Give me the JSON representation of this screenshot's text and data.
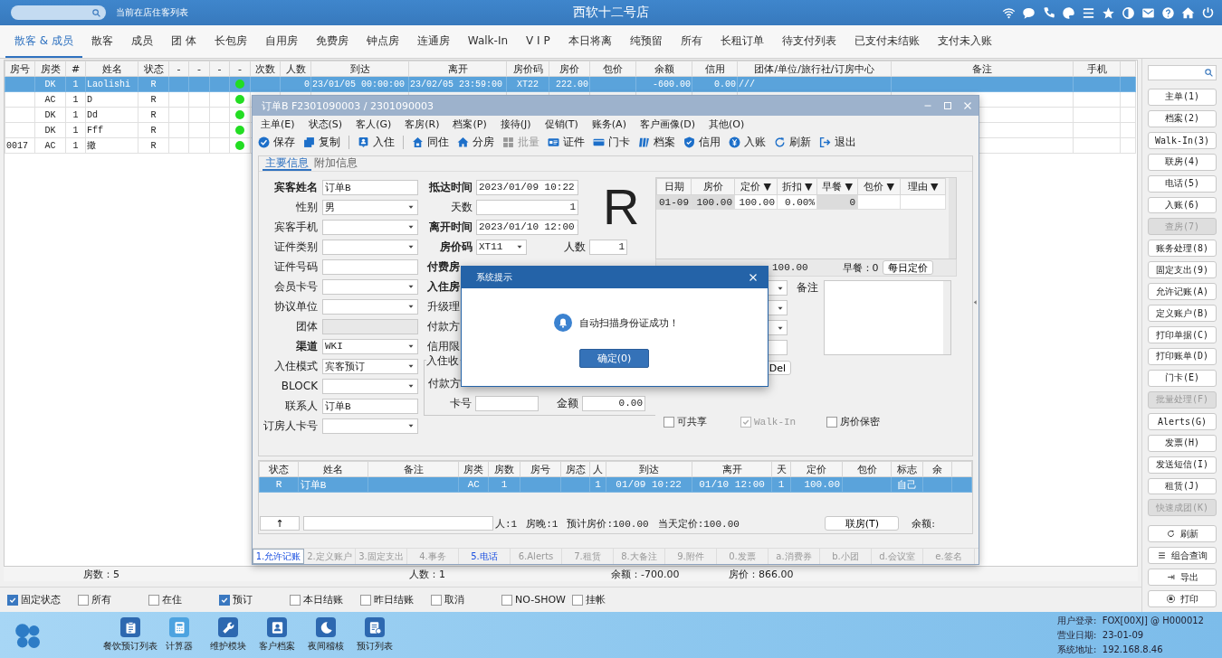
{
  "top_bar": {
    "subtitle": "当前在店住客列表",
    "title": "西软十二号店"
  },
  "tabs": [
    {
      "label": "散客 & 成员",
      "selected": true
    },
    {
      "label": "散客",
      "selected": false
    },
    {
      "label": "成员",
      "selected": false
    },
    {
      "label": "团 体",
      "selected": false
    },
    {
      "label": "长包房",
      "selected": false
    },
    {
      "label": "自用房",
      "selected": false
    },
    {
      "label": "免费房",
      "selected": false
    },
    {
      "label": "钟点房",
      "selected": false
    },
    {
      "label": "连通房",
      "selected": false
    },
    {
      "label": "Walk-In",
      "selected": false
    },
    {
      "label": "V I P",
      "selected": false
    },
    {
      "label": "本日将离",
      "selected": false
    },
    {
      "label": "纯预留",
      "selected": false
    },
    {
      "label": "所有",
      "selected": false
    },
    {
      "label": "长租订单",
      "selected": false
    },
    {
      "label": "待支付列表",
      "selected": false
    },
    {
      "label": "已支付未结账",
      "selected": false
    },
    {
      "label": "支付未入账",
      "selected": false
    }
  ],
  "guest_table": {
    "columns": [
      "房号",
      "房类",
      "#",
      "姓名",
      "状态",
      "-",
      "-",
      "-",
      "-",
      "次数",
      "人数",
      "到达",
      "离开",
      "房价码",
      "房价",
      "包价",
      "余额",
      "信用",
      "团体/单位/旅行社/订房中心",
      "备注",
      "手机"
    ],
    "rows": [
      {
        "selected": true,
        "status_dot": true,
        "cells": [
          "",
          "DK",
          "1",
          "Laolishi",
          "R",
          "",
          "",
          "",
          "",
          "",
          "0",
          "23/01/05 00:00:00",
          "23/02/05 23:59:00",
          "XT22",
          "222.00",
          "",
          "-600.00",
          "0.00",
          "///",
          "",
          ""
        ]
      },
      {
        "selected": false,
        "status_dot": true,
        "cells": [
          "",
          "AC",
          "1",
          "D",
          "R",
          "",
          "",
          "",
          ""
        ]
      },
      {
        "selected": false,
        "status_dot": true,
        "cells": [
          "",
          "DK",
          "1",
          "Dd",
          "R",
          "",
          "",
          "",
          ""
        ]
      },
      {
        "selected": false,
        "status_dot": true,
        "cells": [
          "",
          "DK",
          "1",
          "Fff",
          "R",
          "",
          "",
          "",
          ""
        ]
      },
      {
        "selected": false,
        "status_dot": true,
        "cells": [
          "0017",
          "AC",
          "1",
          "撒",
          "R",
          "",
          "",
          "",
          ""
        ]
      }
    ]
  },
  "totals": [
    "房数：5",
    "人数：1",
    "余额：-700.00",
    "房价：866.00"
  ],
  "sidebar": {
    "buttons": [
      {
        "label": "主单(1)",
        "disabled": false
      },
      {
        "label": "档案(2)",
        "disabled": false
      },
      {
        "label": "Walk-In(3)",
        "disabled": false
      },
      {
        "label": "联房(4)",
        "disabled": false
      },
      {
        "label": "电话(5)",
        "disabled": false
      },
      {
        "label": "入账(6)",
        "disabled": false
      },
      {
        "label": "查房(7)",
        "disabled": true
      },
      {
        "label": "账务处理(8)",
        "disabled": false
      },
      {
        "label": "固定支出(9)",
        "disabled": false
      },
      {
        "label": "允许记账(A)",
        "disabled": false
      },
      {
        "label": "定义账户(B)",
        "disabled": false
      },
      {
        "label": "打印单据(C)",
        "disabled": false
      },
      {
        "label": "打印账单(D)",
        "disabled": false
      },
      {
        "label": "门卡(E)",
        "disabled": false
      },
      {
        "label": "批量处理(F)",
        "disabled": true
      },
      {
        "label": "Alerts(G)",
        "disabled": false
      },
      {
        "label": "发票(H)",
        "disabled": false
      },
      {
        "label": "发送短信(I)",
        "disabled": false
      },
      {
        "label": "租赁(J)",
        "disabled": false
      },
      {
        "label": "快速成团(K)",
        "disabled": true
      }
    ],
    "actions": [
      {
        "label": "刷新",
        "kind": "refresh"
      },
      {
        "label": "组合查询",
        "kind": "menu"
      },
      {
        "label": "导出",
        "kind": "export"
      },
      {
        "label": "打印",
        "kind": "print"
      }
    ]
  },
  "filters": [
    {
      "label": "固定状态",
      "checked": true
    },
    {
      "label": "所有",
      "checked": false
    },
    {
      "label": "在住",
      "checked": false
    },
    {
      "label": "预订",
      "checked": true
    },
    {
      "label": "本日结账",
      "checked": false
    },
    {
      "label": "昨日结账",
      "checked": false
    },
    {
      "label": "取消",
      "checked": false
    },
    {
      "label": "NO-SHOW",
      "checked": false
    },
    {
      "label": "挂帐",
      "checked": false
    }
  ],
  "dock": {
    "apps": [
      {
        "label": "餐饮预订列表",
        "kind": "clipboard"
      },
      {
        "label": "计算器",
        "kind": "calculator"
      },
      {
        "label": "维护模块",
        "kind": "wrench"
      },
      {
        "label": "客户档案",
        "kind": "contact"
      },
      {
        "label": "夜间稽核",
        "kind": "moon"
      },
      {
        "label": "预订列表",
        "kind": "list"
      }
    ],
    "info": [
      "用户登录:  FOX[00XJ] @ H000012",
      "营业日期:  23-01-09",
      "系统地址:  192.168.8.46"
    ]
  },
  "order_window": {
    "title": "订单B  F2301090003 / 2301090003",
    "menu": [
      "主单(E)",
      "状态(S)",
      "客人(G)",
      "客房(R)",
      "档案(P)",
      "接待(J)",
      "促销(T)",
      "账务(A)",
      "客户画像(D)",
      "其他(O)"
    ],
    "toolbar": [
      {
        "label": "保存",
        "kind": "check",
        "disabled": false
      },
      {
        "label": "复制",
        "kind": "copy",
        "disabled": false
      },
      {
        "label": "入住",
        "kind": "badge",
        "disabled": false
      },
      {
        "label": "同住",
        "kind": "house",
        "disabled": false
      },
      {
        "label": "分房",
        "kind": "home",
        "disabled": false
      },
      {
        "label": "批量",
        "kind": "grid",
        "disabled": true
      },
      {
        "label": "证件",
        "kind": "idcard",
        "disabled": false
      },
      {
        "label": "门卡",
        "kind": "card",
        "disabled": false
      },
      {
        "label": "档案",
        "kind": "book",
        "disabled": false
      },
      {
        "label": "信用",
        "kind": "shield",
        "disabled": false
      },
      {
        "label": "入账",
        "kind": "yen",
        "disabled": false
      },
      {
        "label": "刷新",
        "kind": "refresh",
        "disabled": false
      },
      {
        "label": "退出",
        "kind": "exit",
        "disabled": false
      }
    ],
    "subtabs": [
      {
        "label": "主要信息",
        "selected": true
      },
      {
        "label": "附加信息",
        "selected": false
      }
    ],
    "guest_fields": [
      {
        "label": "宾客姓名",
        "value": "订单B",
        "kind": "text",
        "bold": true
      },
      {
        "label": "性别",
        "value": "男",
        "kind": "select",
        "bold": false
      },
      {
        "label": "宾客手机",
        "kind": "select",
        "bold": false
      },
      {
        "label": "证件类别",
        "kind": "select",
        "bold": false
      },
      {
        "label": "证件号码",
        "kind": "text",
        "bold": false
      },
      {
        "label": "会员卡号",
        "kind": "select",
        "bold": false
      },
      {
        "label": "协议单位",
        "kind": "select",
        "bold": false
      },
      {
        "label": "团体",
        "kind": "disabled",
        "bold": false
      },
      {
        "label": "渠道",
        "value": "WKI",
        "kind": "select",
        "bold": true
      },
      {
        "label": "入住模式",
        "value": "宾客预订",
        "kind": "select",
        "bold": false
      },
      {
        "label": "BLOCK",
        "kind": "select",
        "bold": false
      },
      {
        "label": "联系人",
        "value": "订单B",
        "kind": "text",
        "bold": false
      },
      {
        "label": "订房人卡号",
        "kind": "select",
        "bold": false
      }
    ],
    "stay_fields": [
      {
        "label": "抵达时间",
        "value": "2023/01/09 10:22",
        "kind": "select",
        "bold": true
      },
      {
        "label": "天数",
        "value": "1",
        "kind": "number",
        "bold": false
      },
      {
        "label": "离开时间",
        "value": "2023/01/10 12:00",
        "kind": "select",
        "bold": true
      },
      {
        "label": "房价码",
        "value": "XT11",
        "kind": "short-select",
        "bold": true,
        "extra_label": "人数",
        "extra_value": "1"
      },
      {
        "label": "付费房",
        "kind": "covered",
        "bold": true
      },
      {
        "label": "入住房",
        "kind": "covered",
        "bold": true
      },
      {
        "label": "升级理",
        "kind": "covered",
        "bold": false
      },
      {
        "label": "付款方",
        "kind": "covered",
        "bold": false
      },
      {
        "label": "信用限",
        "kind": "covered",
        "bold": false
      }
    ],
    "payment": {
      "legend": "入住收",
      "payer_label": "付款方",
      "card_label": "卡号",
      "amount_label": "金额",
      "amount": "0.00"
    },
    "status_letter": "R",
    "rate_table": {
      "columns": [
        "日期",
        "房价",
        "定价 ▼",
        "折扣 ▼",
        "早餐 ▼",
        "包价 ▼",
        "理由 ▼"
      ],
      "rows": [
        [
          "01-09",
          "100.00",
          "100.00",
          "0.00%",
          "0",
          "",
          ""
        ]
      ]
    },
    "rate_summary": {
      "rate": "100.00",
      "breakfast": "早餐：0",
      "button": "每日定价"
    },
    "remark_label": "备注",
    "del_button": "Del",
    "options": [
      {
        "label": "可共享",
        "checked": false,
        "disabled": false
      },
      {
        "label": "Walk-In",
        "checked": true,
        "disabled": true
      },
      {
        "label": "房价保密",
        "checked": false,
        "disabled": false
      }
    ],
    "booking_table": {
      "columns": [
        "状态",
        "姓名",
        "备注",
        "房类",
        "房数",
        "房号",
        "房态",
        "人",
        "到达",
        "离开",
        "天",
        "定价",
        "包价",
        "标志",
        "余"
      ],
      "rows": [
        {
          "selected": true,
          "cells": [
            "R",
            "订单B",
            "",
            "AC",
            "1",
            "",
            "",
            "1",
            "01/09 10:22",
            "01/10 12:00",
            "1",
            "100.00",
            "",
            "自己",
            ""
          ]
        }
      ],
      "footer": {
        "up": "↑",
        "stats": [
          "人:1",
          "房晚:1",
          "预计房价:100.00",
          "当天定价:100.00"
        ],
        "link_button": "联房(T)",
        "balance_label": "余额:"
      }
    },
    "bottom_tabs": [
      {
        "label": "1.允许记账",
        "selected": true,
        "highlighted": true
      },
      {
        "label": "2.定义账户",
        "selected": false,
        "highlighted": false
      },
      {
        "label": "3.固定支出",
        "selected": false,
        "highlighted": false
      },
      {
        "label": "4.事务",
        "selected": false,
        "highlighted": false
      },
      {
        "label": "5.电话",
        "selected": false,
        "highlighted": true
      },
      {
        "label": "6.Alerts",
        "selected": false,
        "highlighted": false
      },
      {
        "label": "7.租赁",
        "selected": false,
        "highlighted": false
      },
      {
        "label": "8.大备注",
        "selected": false,
        "highlighted": false
      },
      {
        "label": "9.附件",
        "selected": false,
        "highlighted": false
      },
      {
        "label": "0.发票",
        "selected": false,
        "highlighted": false
      },
      {
        "label": "a.消费券",
        "selected": false,
        "highlighted": false
      },
      {
        "label": "b.小团",
        "selected": false,
        "highlighted": false
      },
      {
        "label": "d.会议室",
        "selected": false,
        "highlighted": false
      },
      {
        "label": "e.签名",
        "selected": false,
        "highlighted": false
      }
    ]
  },
  "dialog": {
    "title": "系统提示",
    "message": "自动扫描身份证成功！",
    "button": "确定(0)"
  }
}
